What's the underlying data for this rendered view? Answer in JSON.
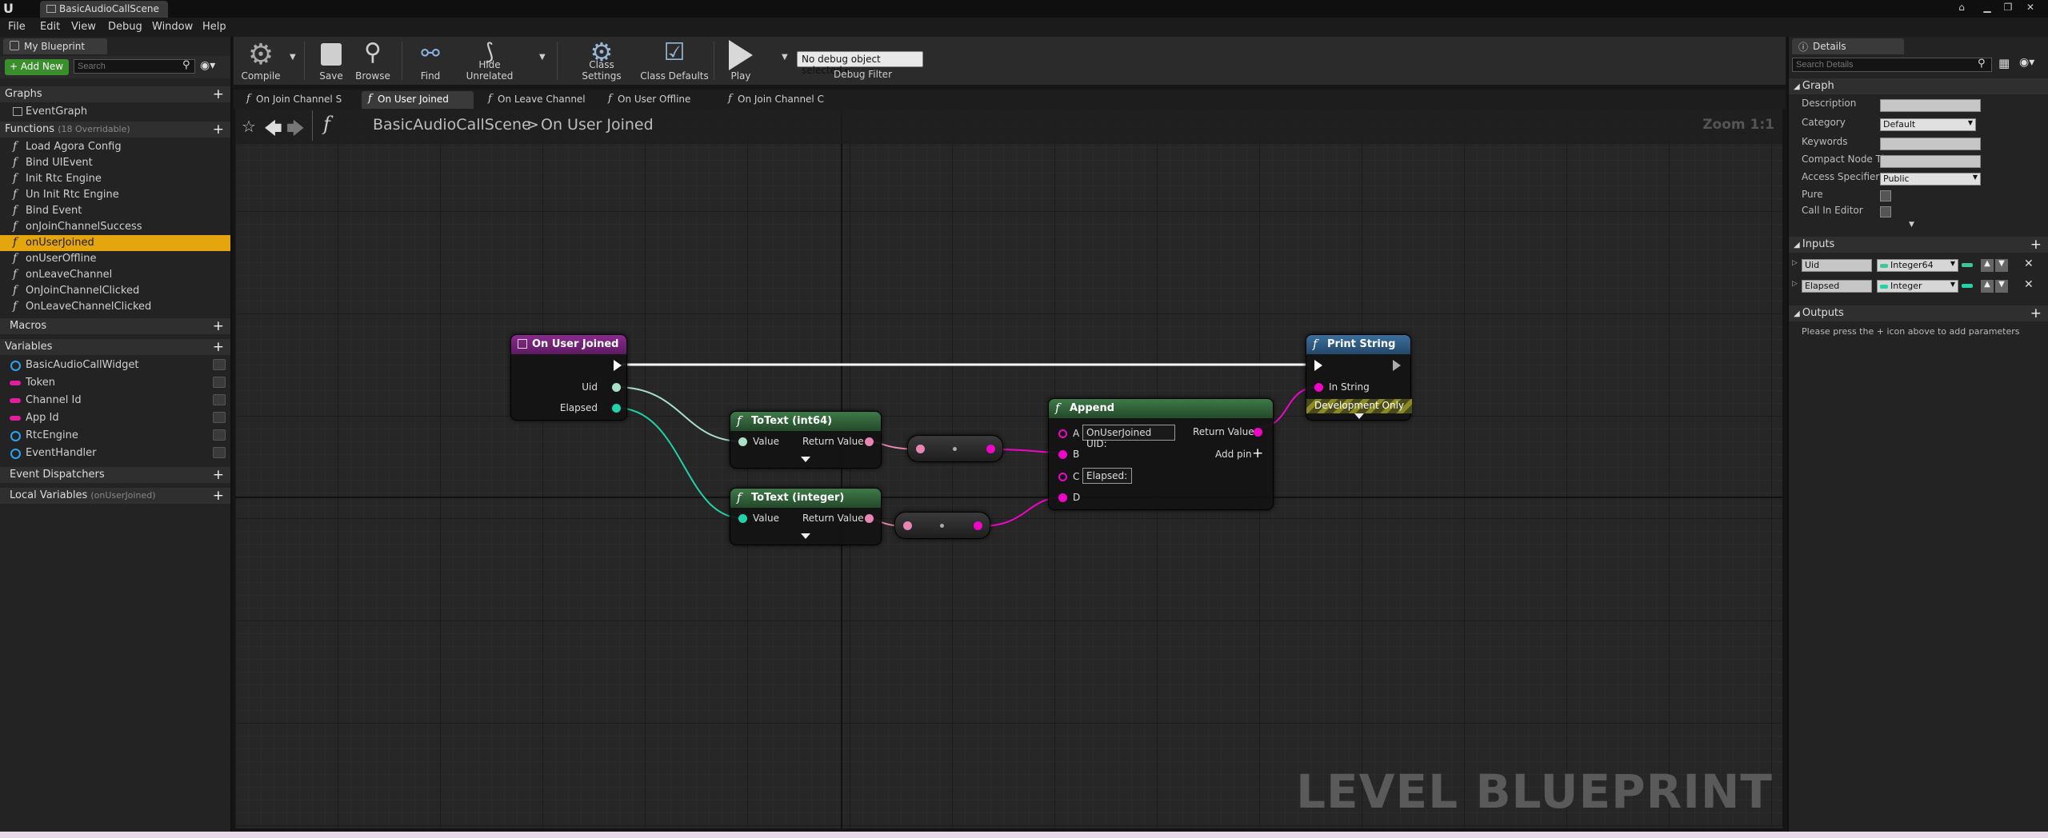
{
  "window": {
    "tab_title": "BasicAudioCallScene",
    "logo": "U"
  },
  "menu": [
    "File",
    "Edit",
    "View",
    "Debug",
    "Window",
    "Help"
  ],
  "left_panel": {
    "tab": "My Blueprint",
    "add_new": "+ Add New",
    "search_placeholder": "Search",
    "graphs_label": "Graphs",
    "graphs": [
      "EventGraph"
    ],
    "functions_label": "Functions",
    "functions_count": "(18 Overridable)",
    "functions": [
      "Load Agora Config",
      "Bind UIEvent",
      "Init Rtc Engine",
      "Un Init Rtc Engine",
      "Bind Event",
      "onJoinChannelSuccess",
      "onUserJoined",
      "onUserOffline",
      "onLeaveChannel",
      "OnJoinChannelClicked",
      "OnLeaveChannelClicked"
    ],
    "selected_function": "onUserJoined",
    "macros_label": "Macros",
    "variables_label": "Variables",
    "variables": [
      {
        "name": "BasicAudioCallWidget",
        "type": "object",
        "color": "#2aa4f0"
      },
      {
        "name": "Token",
        "type": "string",
        "color": "#e01fa0"
      },
      {
        "name": "Channel Id",
        "type": "string",
        "color": "#e01fa0"
      },
      {
        "name": "App Id",
        "type": "string",
        "color": "#e01fa0"
      },
      {
        "name": "RtcEngine",
        "type": "object",
        "color": "#2aa4f0"
      },
      {
        "name": "EventHandler",
        "type": "object",
        "color": "#2aa4f0"
      }
    ],
    "dispatchers_label": "Event Dispatchers",
    "local_vars_label": "Local Variables",
    "local_vars_scope": "(onUserJoined)"
  },
  "toolbar": {
    "compile": "Compile",
    "save": "Save",
    "browse": "Browse",
    "find": "Find",
    "hide_unrelated": "Hide Unrelated",
    "class_settings": "Class Settings",
    "class_defaults": "Class Defaults",
    "play": "Play",
    "debug_object": "No debug object selected",
    "debug_filter": "Debug Filter"
  },
  "graph_tabs": [
    "On Join Channel S",
    "On User Joined",
    "On Leave Channel",
    "On User Offline",
    "On Join Channel C"
  ],
  "active_graph_tab": "On User Joined",
  "breadcrumb": {
    "scene": "BasicAudioCallScene",
    "separator": ">",
    "func": "On User Joined"
  },
  "zoom": "Zoom 1:1",
  "watermark": "LEVEL BLUEPRINT",
  "nodes": {
    "entry": {
      "title": "On User Joined",
      "pins": [
        "Uid",
        "Elapsed"
      ]
    },
    "totext_int64": {
      "title": "ToText (int64)",
      "in": "Value",
      "out": "Return Value"
    },
    "totext_int": {
      "title": "ToText (integer)",
      "in": "Value",
      "out": "Return Value"
    },
    "append": {
      "title": "Append",
      "pins": [
        "A",
        "B",
        "C",
        "D"
      ],
      "a_value": "OnUserJoined UID:",
      "c_value": "Elapsed:",
      "out": "Return Value",
      "add_pin": "Add pin"
    },
    "print_string": {
      "title": "Print String",
      "in": "In String",
      "dev_only": "Development Only"
    }
  },
  "details": {
    "tab": "Details",
    "search_placeholder": "Search Details",
    "graph_label": "Graph",
    "rows": [
      {
        "label": "Description",
        "value": ""
      },
      {
        "label": "Category",
        "value": "Default"
      },
      {
        "label": "Keywords",
        "value": ""
      },
      {
        "label": "Compact Node Ti",
        "value": ""
      },
      {
        "label": "Access Specifier",
        "value": "Public"
      },
      {
        "label": "Pure",
        "value": ""
      },
      {
        "label": "Call In Editor",
        "value": ""
      }
    ],
    "inputs_label": "Inputs",
    "inputs": [
      {
        "name": "Uid",
        "type": "Integer64",
        "color": "#3ec59a"
      },
      {
        "name": "Elapsed",
        "type": "Integer",
        "color": "#20d3a8"
      }
    ],
    "outputs_label": "Outputs",
    "outputs_hint": "Please press the + icon above to add parameters"
  },
  "colors": {
    "accent": "#e5a50d",
    "event_header": "#7c1d80",
    "pure_header": "#2f5c36",
    "call_header": "#2a5b87",
    "int64_pin": "#a8e0c8",
    "int_pin": "#20d3a8",
    "text_pin": "#e985b2",
    "string_pin": "#f005c8"
  }
}
